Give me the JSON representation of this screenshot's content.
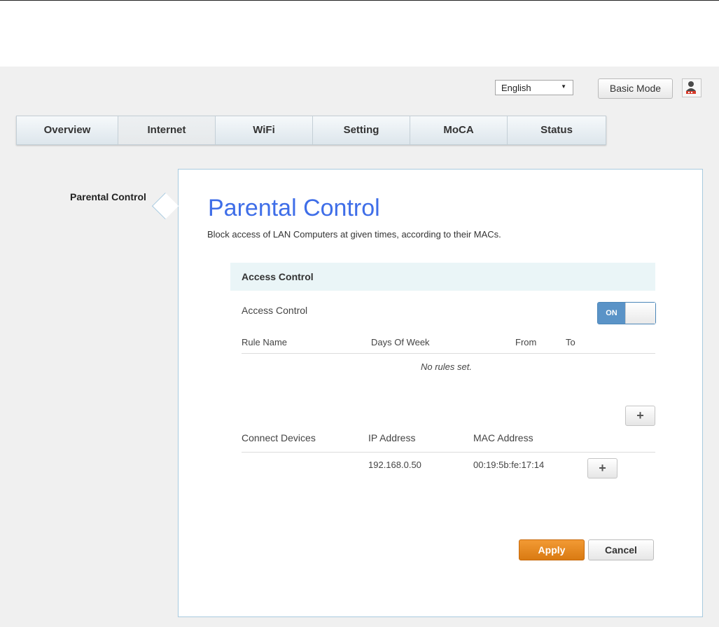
{
  "header": {
    "language": {
      "selected": "English"
    },
    "mode_button": "Basic Mode",
    "user_icon": "user-lock-icon"
  },
  "nav": {
    "tabs": [
      {
        "label": "Overview"
      },
      {
        "label": "Internet",
        "active": true
      },
      {
        "label": "WiFi"
      },
      {
        "label": "Setting"
      },
      {
        "label": "MoCA"
      },
      {
        "label": "Status"
      }
    ]
  },
  "sidebar": {
    "items": [
      {
        "label": "Parental Control"
      }
    ]
  },
  "main": {
    "title": "Parental Control",
    "subtitle": "Block access of LAN Computers at given times, according to their MACs.",
    "section_title": "Access Control",
    "access_control": {
      "label": "Access Control",
      "toggle_state": "ON"
    },
    "rules_table": {
      "columns": [
        "Rule Name",
        "Days Of Week",
        "From",
        "To"
      ],
      "empty_text": "No rules set."
    },
    "devices_table": {
      "columns": [
        "Connect Devices",
        "IP Address",
        "MAC Address"
      ],
      "rows": [
        {
          "device": "",
          "ip": "192.168.0.50",
          "mac": "00:19:5b:fe:17:14"
        }
      ]
    },
    "add_symbol": "+",
    "apply_label": "Apply",
    "cancel_label": "Cancel"
  },
  "colors": {
    "title_blue": "#3f6ee8",
    "apply_orange": "#e8861f",
    "toggle_blue": "#5a93c7",
    "section_bg": "#eaf5f7",
    "panel_border": "#a8cadf"
  }
}
